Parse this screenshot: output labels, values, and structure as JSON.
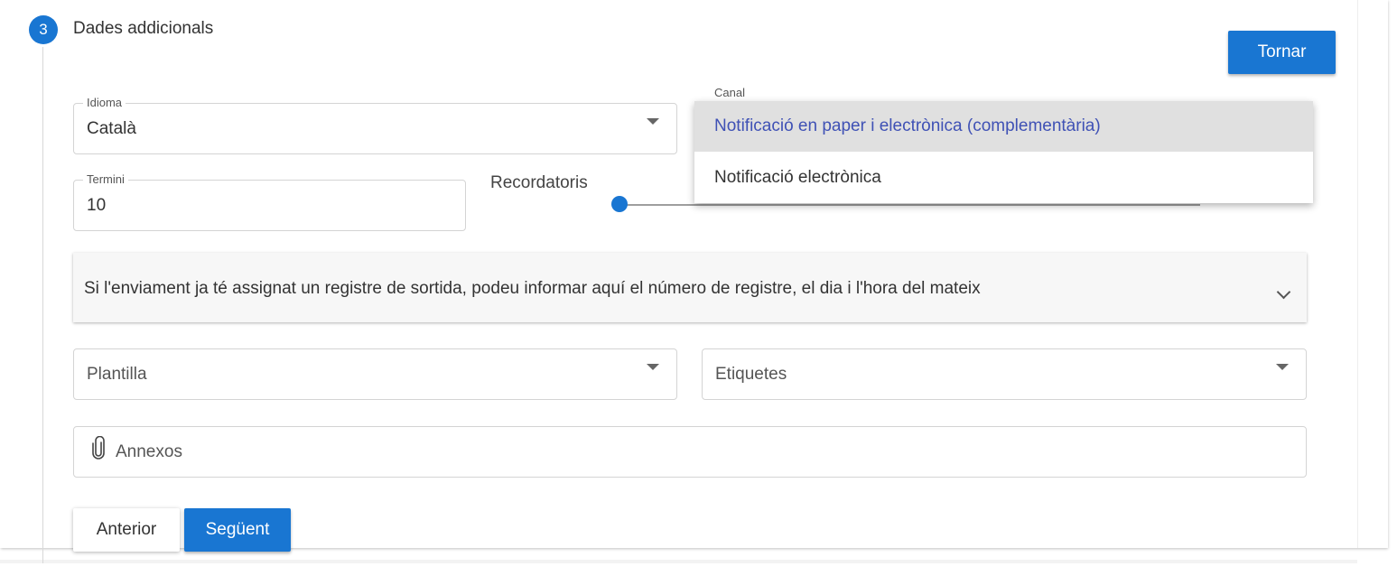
{
  "step": {
    "number": "3",
    "title": "Dades addicionals"
  },
  "buttons": {
    "back_label": "Tornar",
    "previous_label": "Anterior",
    "next_label": "Següent"
  },
  "idioma": {
    "label": "Idioma",
    "value": "Català"
  },
  "canal": {
    "label": "Canal",
    "options": [
      {
        "label": "Notificació en paper i electrònica (complementària)",
        "selected": true
      },
      {
        "label": "Notificació electrònica",
        "selected": false
      }
    ]
  },
  "termini": {
    "label": "Termini",
    "value": "10"
  },
  "recordatoris": {
    "label": "Recordatoris"
  },
  "registre_panel": {
    "text": "Si l'enviament ja té assignat un registre de sortida, podeu informar aquí el número de registre, el dia i l'hora del mateix"
  },
  "plantilla": {
    "placeholder": "Plantilla"
  },
  "etiquetes": {
    "placeholder": "Etiquetes"
  },
  "annexos": {
    "placeholder": "Annexos"
  },
  "colors": {
    "primary": "#1976d2",
    "selected_option_text": "#3f51b5",
    "selected_option_bg": "#e0e0e0"
  }
}
